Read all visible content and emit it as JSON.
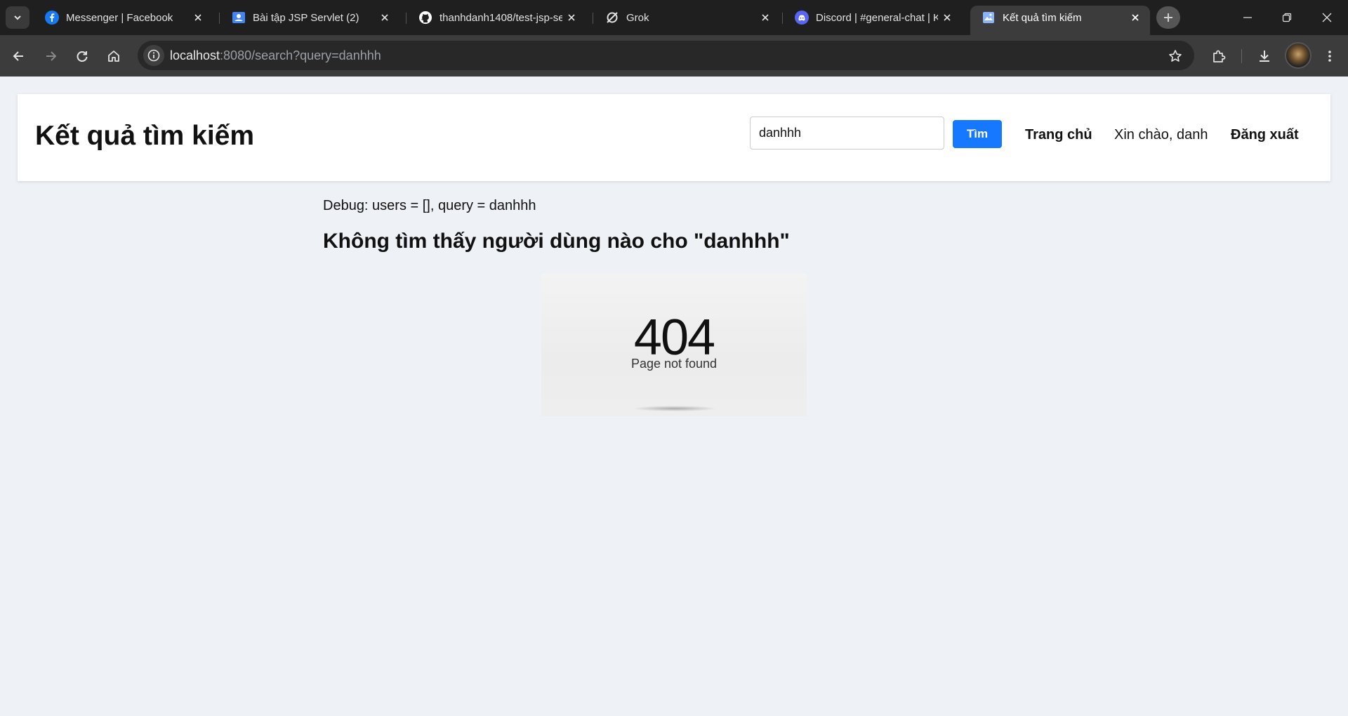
{
  "browser": {
    "tabs": [
      {
        "title": "Messenger | Facebook",
        "icon": "facebook-icon",
        "color": "#1877f2"
      },
      {
        "title": "Bài tập JSP Servlet (2)",
        "icon": "classroom-icon",
        "color": "#4285f4"
      },
      {
        "title": "thanhdanh1408/test-jsp-se",
        "icon": "github-icon",
        "color": "#ffffff"
      },
      {
        "title": "Grok",
        "icon": "grok-icon",
        "color": "#ffffff"
      },
      {
        "title": "Discord | #general-chat | K",
        "icon": "discord-icon",
        "color": "#5865f2"
      },
      {
        "title": "Kết quả tìm kiếm",
        "icon": "page-icon",
        "color": "#8ab4f8",
        "active": true
      }
    ],
    "url_host": "localhost",
    "url_rest": ":8080/search?query=danhhh"
  },
  "page": {
    "title": "Kết quả tìm kiếm",
    "search": {
      "value": "danhhh",
      "button_label": "Tìm"
    },
    "nav": {
      "home": "Trang chủ",
      "greeting": "Xin chào, danh",
      "logout": "Đăng xuất"
    },
    "debug": "Debug: users = [], query = danhhh",
    "result_heading": "Không tìm thấy người dùng nào cho \"danhhh\"",
    "not_found": {
      "code": "404",
      "text": "Page not found"
    }
  },
  "colors": {
    "accent": "#1677ff",
    "background": "#eef1f6"
  }
}
